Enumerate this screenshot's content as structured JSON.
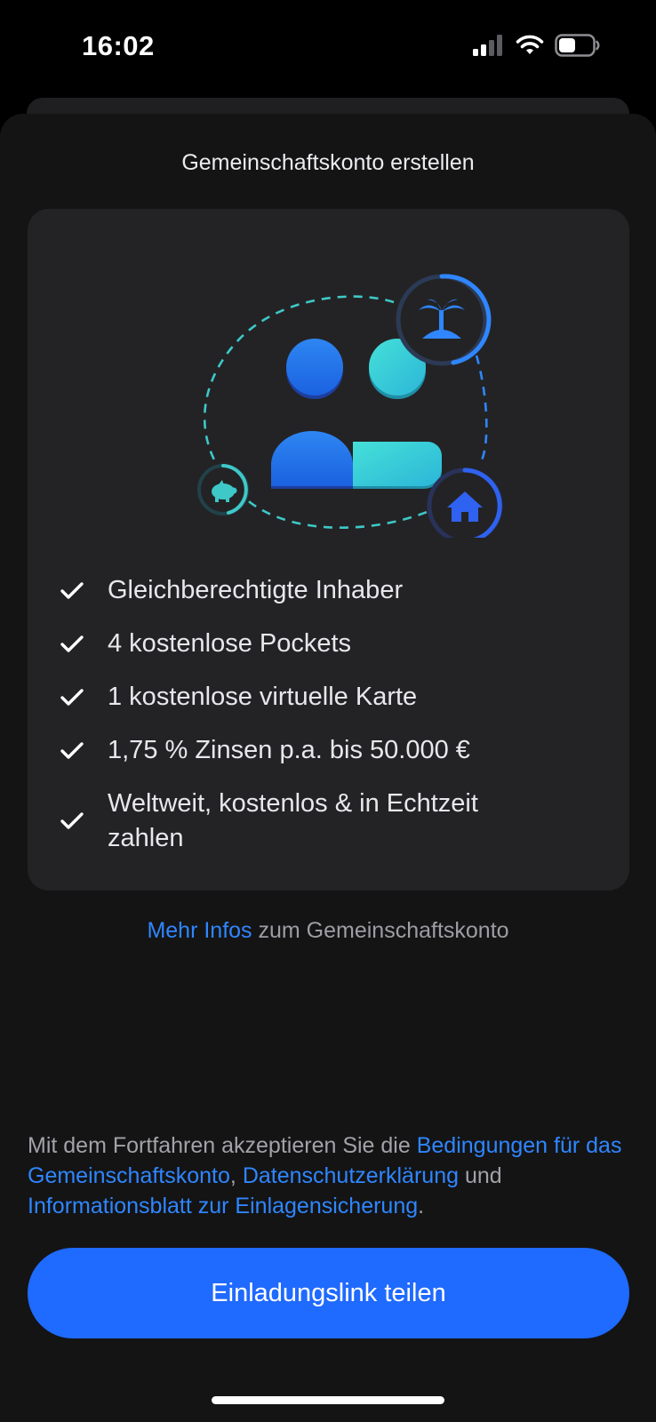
{
  "status_bar": {
    "time": "16:02",
    "icons": [
      "cellular-signal-icon",
      "wifi-icon",
      "battery-icon"
    ]
  },
  "sheet": {
    "title": "Gemeinschaftskonto erstellen",
    "illustration": {
      "icons": [
        "person-icon",
        "person-icon",
        "palm-island-icon",
        "piggy-bank-icon",
        "house-icon"
      ]
    },
    "features": [
      {
        "text": "Gleichberechtigte Inhaber",
        "icon": "checkmark-icon"
      },
      {
        "text": "4 kostenlose Pockets",
        "icon": "checkmark-icon"
      },
      {
        "text": "1 kostenlose virtuelle Karte",
        "icon": "checkmark-icon"
      },
      {
        "text": "1,75 % Zinsen p.a. bis 50.000 €",
        "icon": "checkmark-icon"
      },
      {
        "text": "Weltweit, kostenlos & in Echtzeit zahlen",
        "icon": "checkmark-icon"
      }
    ],
    "more_info": {
      "link": "Mehr Infos",
      "rest": " zum Gemeinschaftskonto"
    },
    "legal": {
      "prefix": "Mit dem Fortfahren akzeptieren Sie die ",
      "terms_link": "Bedingungen für das Gemeinschaftskonto",
      "sep1": ", ",
      "privacy_link": "Datenschutzerklärung",
      "sep2": " und ",
      "info_link": "Informationsblatt zur Einlagensicherung",
      "suffix": "."
    },
    "cta_label": "Einladungslink teilen"
  },
  "colors": {
    "background": "#000000",
    "sheet": "#141415",
    "card": "#232325",
    "accent": "#1f6aff",
    "link": "#2f86ff",
    "teal": "#3ec8c8"
  }
}
